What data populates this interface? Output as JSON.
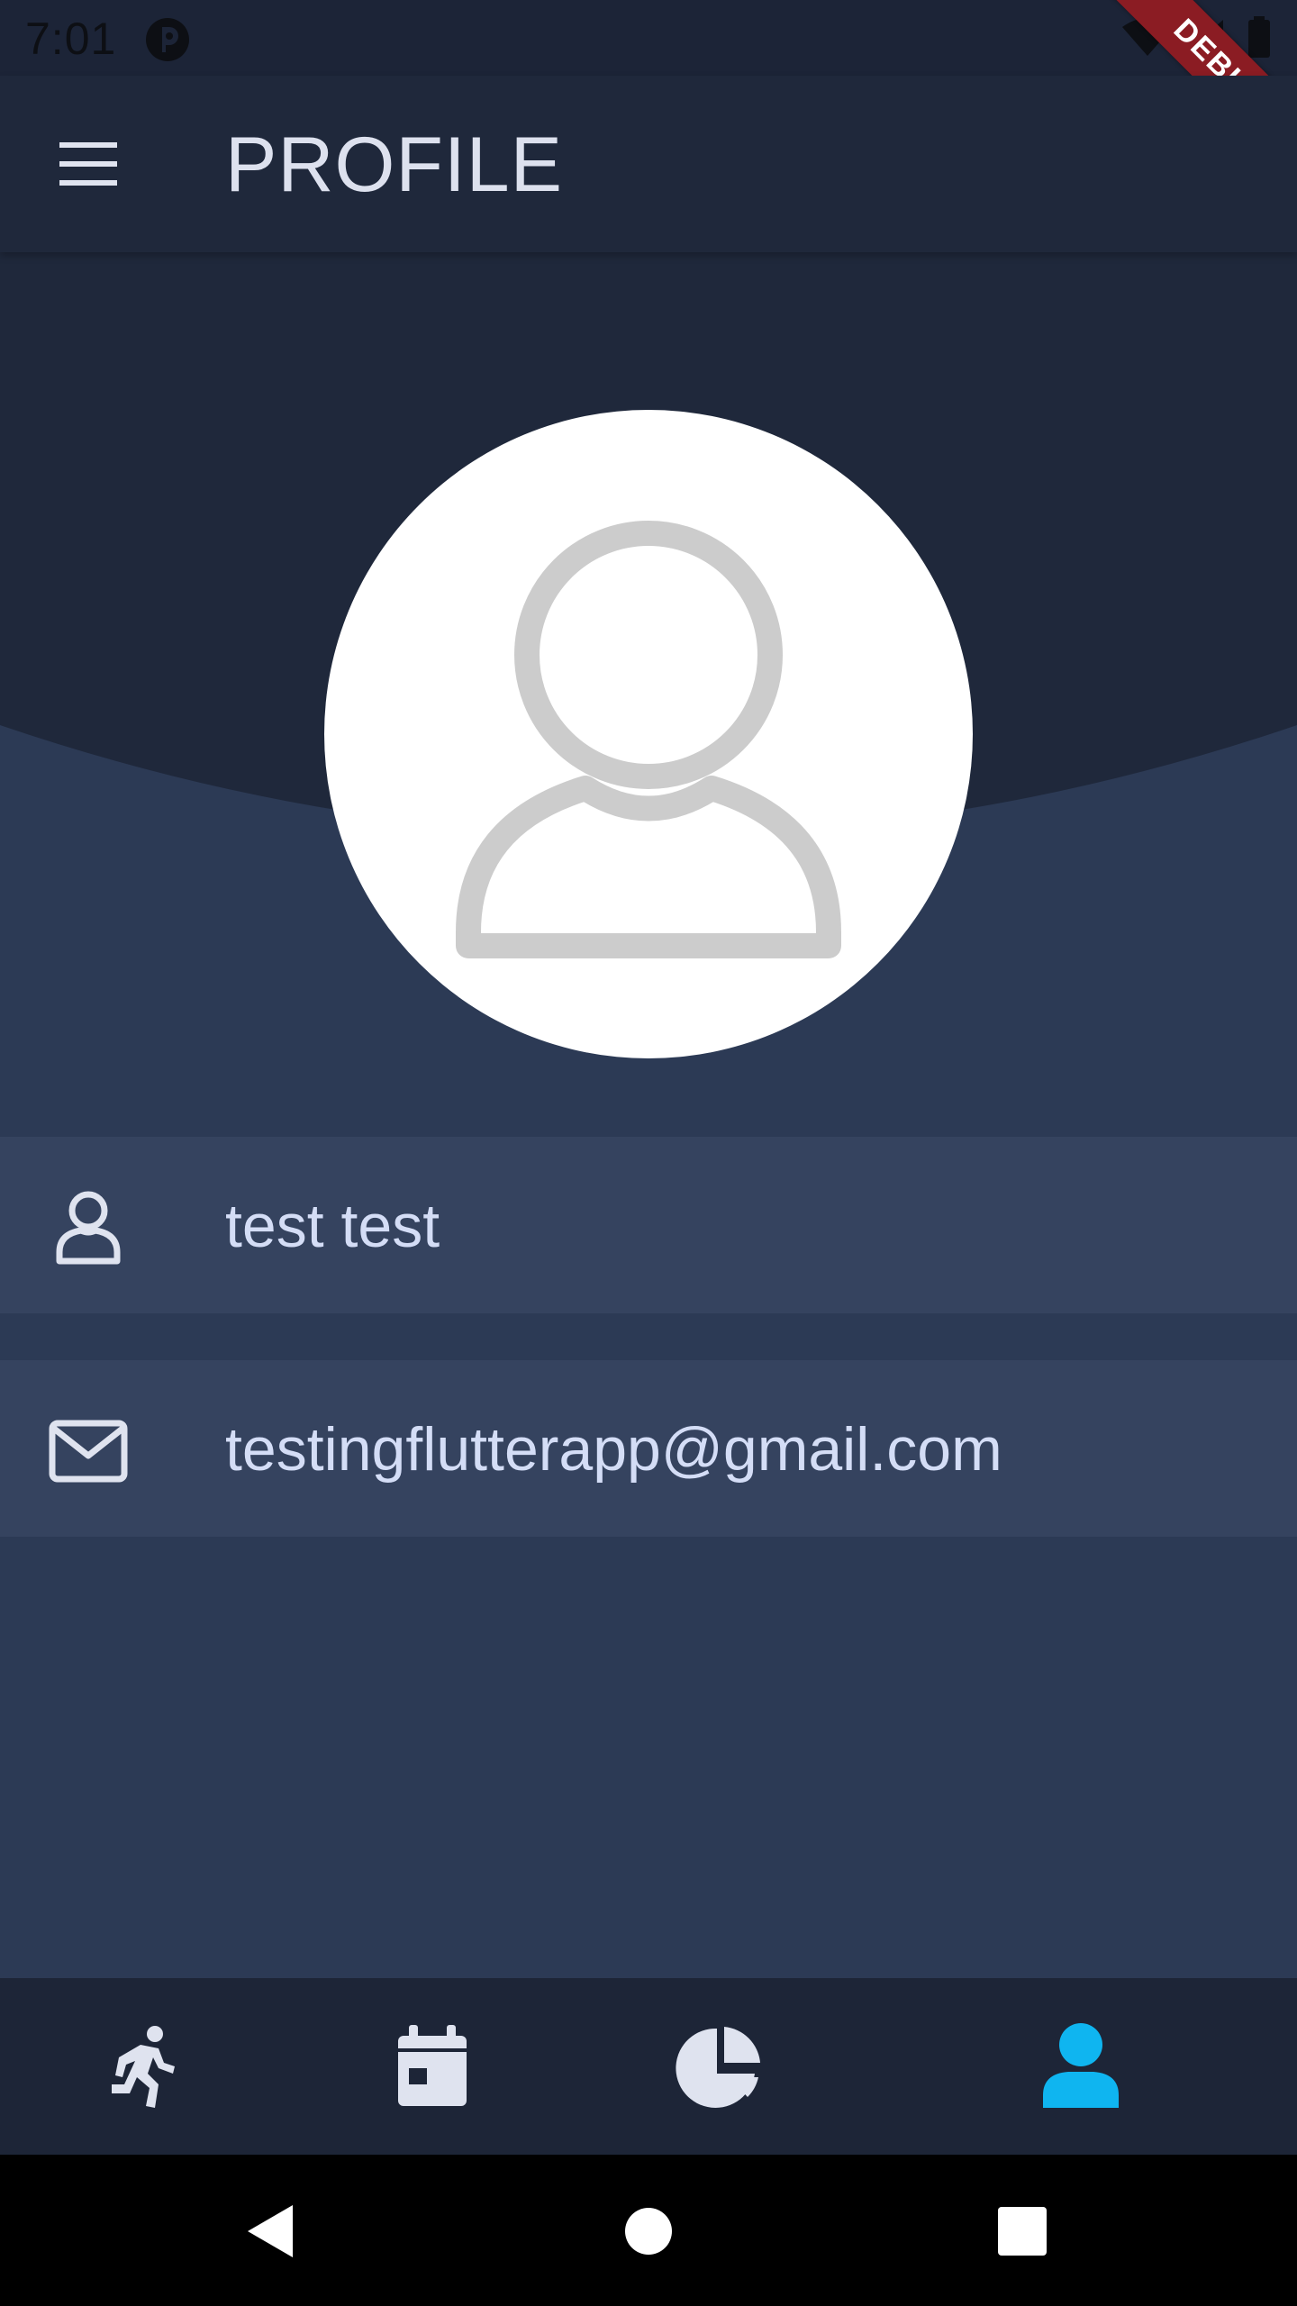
{
  "status_bar": {
    "time": "7:01",
    "icons": [
      "app-notification-icon",
      "wifi-icon",
      "signal-icon",
      "battery-icon"
    ]
  },
  "debug_banner": "DEBUG",
  "app_bar": {
    "title": "PROFILE",
    "menu_icon": "menu-icon"
  },
  "profile": {
    "avatar_icon": "user-placeholder-icon",
    "name": "test test",
    "email": "testingflutterapp@gmail.com"
  },
  "bottom_nav": {
    "items": [
      {
        "icon": "running-icon",
        "active": false
      },
      {
        "icon": "calendar-icon",
        "active": false
      },
      {
        "icon": "pie-chart-icon",
        "active": false
      },
      {
        "icon": "person-icon",
        "active": true
      }
    ]
  },
  "system_nav": [
    "back-icon",
    "home-icon",
    "recents-icon"
  ],
  "colors": {
    "background": "#2c3a55",
    "header": "#1f283b",
    "row": "#35435f",
    "text": "#d4ddf6",
    "accent": "#0fb5f0",
    "icon": "#dfe3ef"
  }
}
